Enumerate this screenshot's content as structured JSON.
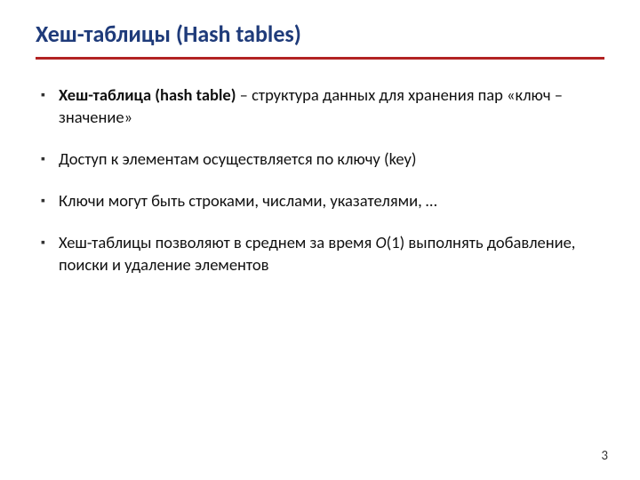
{
  "title": "Хеш-таблицы (Hash tables)",
  "bullets": [
    {
      "bold": "Хеш-таблица (hash table)",
      "rest": " – структура данных для хранения пар «ключ – значение»"
    },
    {
      "rest": "Доступ к элементам осуществляется по ключу (key)"
    },
    {
      "rest": "Ключи могут быть строками, числами, указателями, …"
    },
    {
      "pre": "Хеш-таблицы позволяют в среднем за время ",
      "italic": "O",
      "post": "(1) выполнять добавление, поиски и удаление элементов"
    }
  ],
  "pageNumber": "3"
}
